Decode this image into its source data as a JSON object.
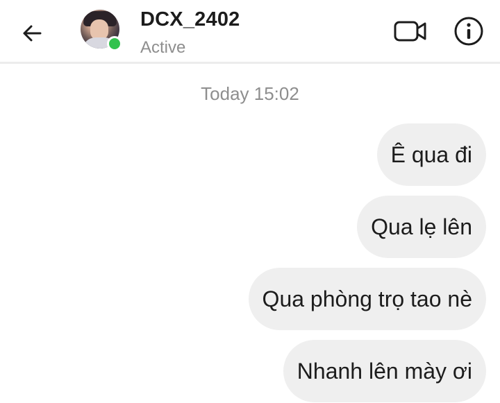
{
  "header": {
    "contact_name": "DCX_2402",
    "status": "Active",
    "back_icon": "arrow-left-icon",
    "video_icon": "video-call-icon",
    "info_icon": "info-icon",
    "online_color": "#31c24d"
  },
  "conversation": {
    "timestamp": "Today 15:02",
    "messages": [
      {
        "text": "Ê qua đi"
      },
      {
        "text": "Qua lẹ lên"
      },
      {
        "text": "Qua phòng trọ tao nè"
      },
      {
        "text": "Nhanh lên mày ơi"
      }
    ]
  },
  "colors": {
    "bubble_background": "#efefef",
    "text": "#1c1c1c",
    "secondary_text": "#8e8e8e"
  }
}
